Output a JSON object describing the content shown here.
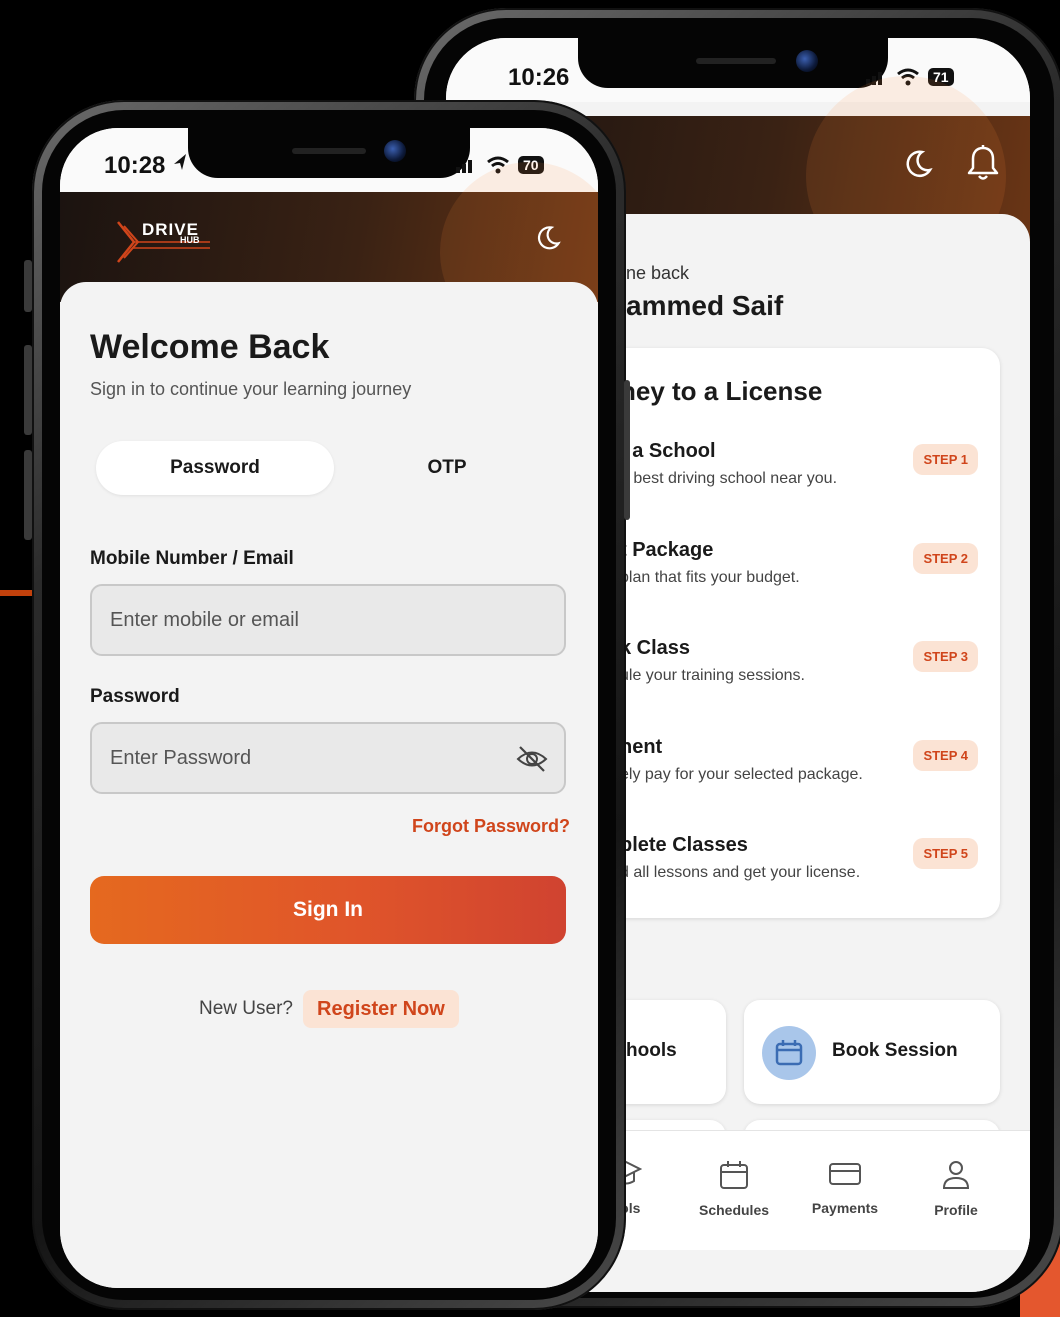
{
  "back_phone": {
    "status": {
      "time": "10:26",
      "battery": "71"
    },
    "welcome_small": "ne back",
    "welcome_name": "ammed Saif",
    "journey": {
      "title": "ney to a License",
      "steps": [
        {
          "title": "t a School",
          "desc": "e best driving school near you.",
          "badge": "STEP 1"
        },
        {
          "title": "t Package",
          "desc": "plan that fits your budget.",
          "badge": "STEP 2"
        },
        {
          "title": "k Class",
          "desc": "ule your training sessions.",
          "badge": "STEP 3"
        },
        {
          "title": "nent",
          "desc": "ely pay for your selected package.",
          "badge": "STEP 4"
        },
        {
          "title": "plete Classes",
          "desc": "d all lessons and get your license.",
          "badge": "STEP 5"
        }
      ]
    },
    "section_fragment": "s",
    "quick_actions": [
      {
        "label": "hools"
      },
      {
        "label": "Book Session",
        "icon": "calendar-icon"
      }
    ],
    "nav": [
      {
        "label": "ools",
        "icon": "school-icon"
      },
      {
        "label": "Schedules",
        "icon": "calendar-icon"
      },
      {
        "label": "Payments",
        "icon": "card-icon"
      },
      {
        "label": "Profile",
        "icon": "user-icon"
      }
    ]
  },
  "front_phone": {
    "status": {
      "time": "10:28",
      "battery": "70"
    },
    "logo": {
      "line1": "DRIVE",
      "line2": "HUB"
    },
    "title": "Welcome Back",
    "subtitle": "Sign in to continue your learning journey",
    "tabs": {
      "password": "Password",
      "otp": "OTP",
      "active": "Password"
    },
    "mobile_label": "Mobile Number / Email",
    "mobile_placeholder": "Enter mobile or email",
    "password_label": "Password",
    "password_placeholder": "Enter Password",
    "forgot": "Forgot Password?",
    "signin": "Sign In",
    "new_user": "New User?",
    "register": "Register Now"
  },
  "colors": {
    "accent": "#d0451b",
    "accent_light": "#fbe3d4",
    "button_start": "#e5691f",
    "button_end": "#d04330",
    "header_dark": "#1b1310",
    "icon_blue": "#a9c6ea"
  }
}
